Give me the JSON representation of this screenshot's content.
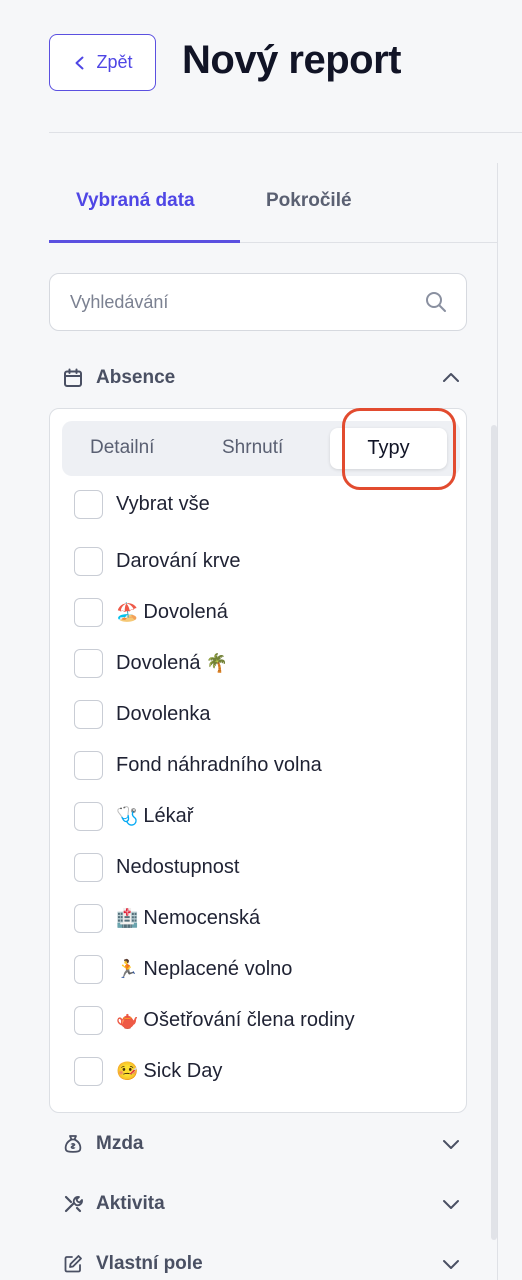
{
  "header": {
    "back_label": "Zpět",
    "title": "Nový report"
  },
  "tabs": [
    {
      "label": "Vybraná data",
      "active": true
    },
    {
      "label": "Pokročilé",
      "active": false
    }
  ],
  "search": {
    "placeholder": "Vyhledávání",
    "value": ""
  },
  "absence": {
    "title": "Absence",
    "expanded": true,
    "segments": [
      "Detailní",
      "Shrnutí",
      "Typy"
    ],
    "active_segment": "Typy",
    "select_all": "Vybrat vše",
    "items": [
      {
        "label": "Darování krve",
        "icon": ""
      },
      {
        "label": "Dovolená",
        "icon": "🏖️"
      },
      {
        "label": "Dovolená",
        "icon_after": "🌴"
      },
      {
        "label": "Dovolenka",
        "icon": ""
      },
      {
        "label": "Fond náhradního volna",
        "icon": ""
      },
      {
        "label": "Lékař",
        "icon": "🩺"
      },
      {
        "label": "Nedostupnost",
        "icon": ""
      },
      {
        "label": "Nemocenská",
        "icon": "🏥"
      },
      {
        "label": "Neplacené volno",
        "icon": "🏃"
      },
      {
        "label": "Ošetřování člena rodiny",
        "icon": "🫖"
      },
      {
        "label": "Sick Day",
        "icon": "🤒"
      }
    ]
  },
  "sections": [
    {
      "title": "Mzda",
      "icon": "money-bag-icon"
    },
    {
      "title": "Aktivita",
      "icon": "tools-icon"
    },
    {
      "title": "Vlastní pole",
      "icon": "edit-icon"
    }
  ],
  "colors": {
    "accent": "#4f46e5",
    "highlight": "#e24b2f"
  }
}
